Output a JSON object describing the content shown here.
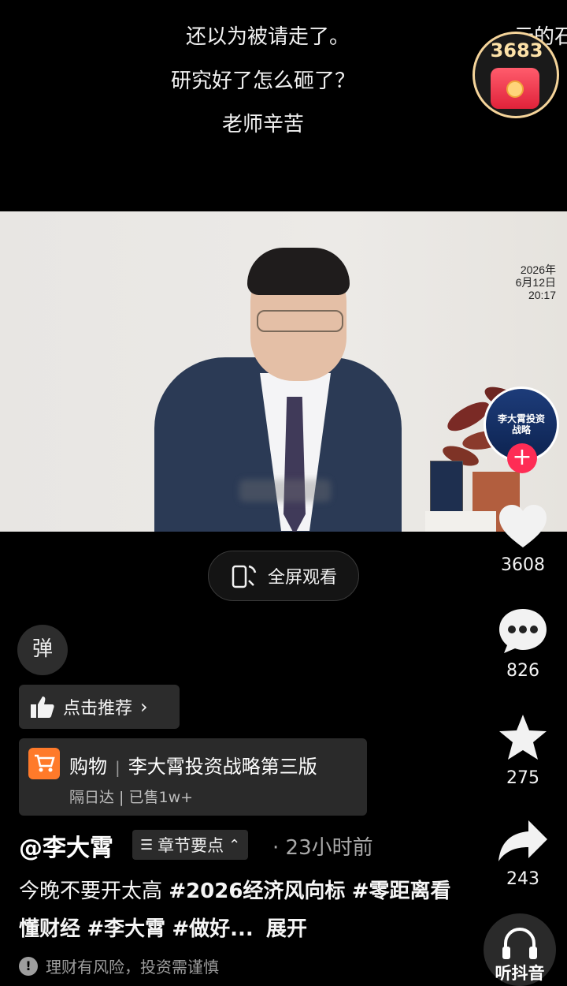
{
  "danmaku": {
    "line1": "还以为被请走了。",
    "line2": "研究好了怎么砸了？",
    "line3": "老师辛苦",
    "clipped_right": "云的石"
  },
  "red_packet": {
    "count": "3683"
  },
  "video": {
    "date_line1": "2026年",
    "date_line2": "6月12日",
    "date_line3": "20:17"
  },
  "creator_avatar": {
    "book_title": "李大霄投资战略"
  },
  "actions": {
    "likes": "3608",
    "comments": "826",
    "favorites": "275",
    "shares": "243"
  },
  "fullscreen": {
    "label": "全屏观看"
  },
  "danmaku_toggle": {
    "label": "弹"
  },
  "recommend": {
    "label": "点击推荐"
  },
  "shop": {
    "category": "购物",
    "product": "李大霄投资战略第三版",
    "subtitle": "隔日达 | 已售1w+"
  },
  "post": {
    "author": "@李大霄",
    "chapters_label": "章节要点",
    "time": "· 23小时前",
    "text": "今晚不要开太高",
    "tags": [
      "#2026经济风向标",
      "#零距离看懂财经",
      "#李大霄",
      "#做好..."
    ],
    "expand": "展开"
  },
  "risk_notice": "理财有风险，投资需谨慎",
  "listen": {
    "label": "听抖音"
  },
  "colors": {
    "accent": "#fe2c55",
    "shop_orange": "#ff7a2a",
    "background": "#000000"
  }
}
